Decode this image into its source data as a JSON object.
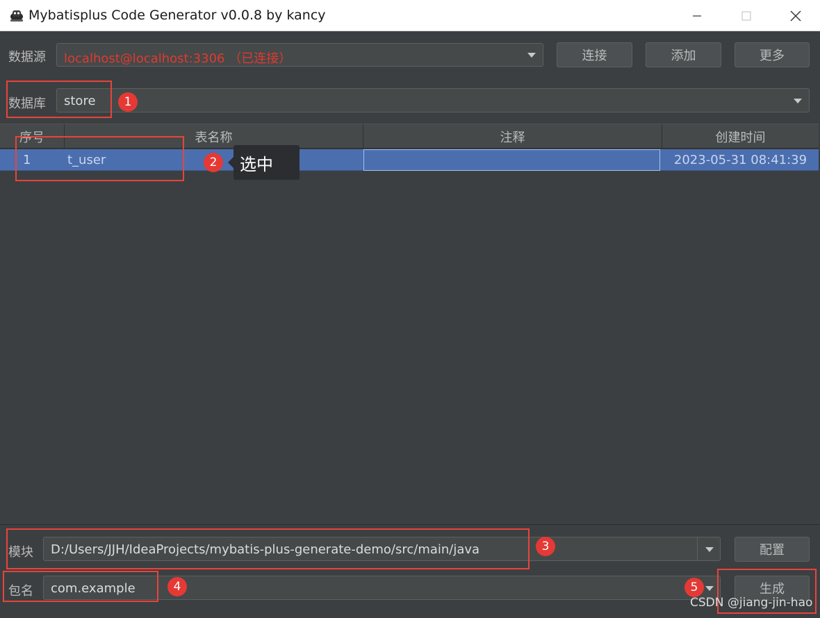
{
  "window": {
    "title": "Mybatisplus Code Generator v0.0.8 by kancy",
    "icon": "robot-logo-icon"
  },
  "datasource": {
    "label": "数据源",
    "value": "localhost@localhost:3306 （已连接）",
    "value_color": "#e03a2f",
    "buttons": {
      "connect": "连接",
      "add": "添加",
      "more": "更多"
    }
  },
  "database": {
    "label": "数据库",
    "value": "store"
  },
  "table": {
    "columns": [
      "序号",
      "表名称",
      "注释",
      "创建时间"
    ],
    "rows": [
      {
        "index": "1",
        "name": "t_user",
        "comment": "",
        "created": "2023-05-31 08:41:39",
        "selected": true
      }
    ],
    "selection_color": "#4b6eaf"
  },
  "module": {
    "label": "模块",
    "value": "D:/Users/JJH/IdeaProjects/mybatis-plus-generate-demo/src/main/java",
    "config_button": "配置"
  },
  "package": {
    "label": "包名",
    "value": "com.example",
    "generate_button": "生成"
  },
  "annotations": {
    "step1": "1",
    "step2": "2",
    "step3": "3",
    "step4": "4",
    "step5": "5",
    "tooltip": "选中",
    "color": "#e53935"
  },
  "watermark": "CSDN @jiang-jin-hao"
}
